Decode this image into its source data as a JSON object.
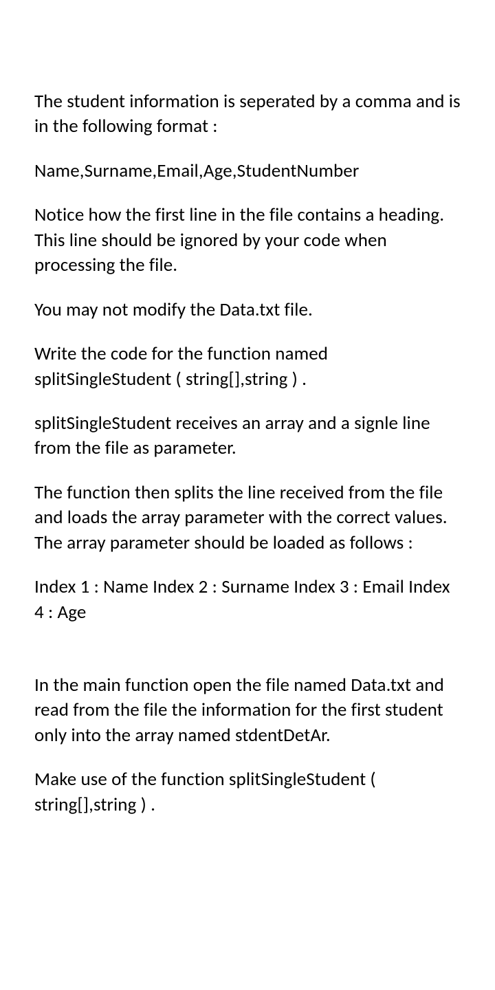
{
  "paragraphs": {
    "p1": "The student information is seperated by a comma and is in the following format :",
    "p2": "Name,Surname,Email,Age,StudentNumber",
    "p3": "Notice how the first line in the file contains a heading. This line should be ignored by your code when processing the file.",
    "p4": "You may not modify the Data.txt file.",
    "p5": "Write the code for the function named splitSingleStudent ( string[],string ) .",
    "p6": "splitSingleStudent receives an array and a signle line from the file as parameter.",
    "p7": "The function then splits the line received from the file and loads the array parameter with the correct values. The array parameter should be loaded as follows :",
    "p8": " Index 1 : Name Index 2 : Surname Index 3 : Email Index 4 : Age",
    "p9": "In the main function open the file named Data.txt and read from the file the information for the first student only into the array named stdentDetAr.",
    "p10": "Make use of the function splitSingleStudent ( string[],string ) ."
  }
}
